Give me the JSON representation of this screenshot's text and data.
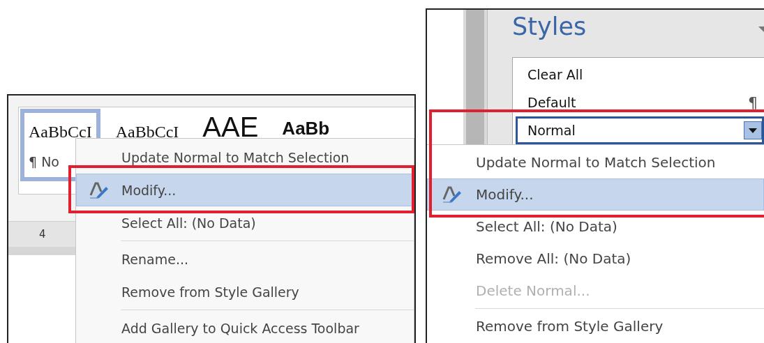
{
  "left_screenshot": {
    "style_gallery": [
      {
        "sample": "AaBbCcI",
        "name": "¶ No",
        "kind": "normal",
        "selected": true
      },
      {
        "sample": "AaBbCcI",
        "kind": "normal",
        "selected": false
      },
      {
        "sample": "AAE",
        "kind": "title",
        "selected": false
      },
      {
        "sample": "AaBb",
        "kind": "heading",
        "selected": false
      }
    ],
    "ruler": {
      "marker": "4"
    },
    "context_menu": [
      {
        "kind": "item",
        "label": "Update Normal to Match Selection",
        "selected": false
      },
      {
        "kind": "icon_item",
        "label": "Modify...",
        "selected": true
      },
      {
        "kind": "item",
        "label": "Select All: (No Data)",
        "selected": false
      },
      {
        "kind": "separator"
      },
      {
        "kind": "item",
        "label": "Rename...",
        "selected": false
      },
      {
        "kind": "item",
        "label": "Remove from Style Gallery",
        "selected": false
      },
      {
        "kind": "separator"
      },
      {
        "kind": "item",
        "label": "Add Gallery to Quick Access Toolbar",
        "selected": false
      }
    ]
  },
  "right_screenshot": {
    "pane_title": "Styles",
    "styles_list": [
      {
        "label": "Clear All",
        "selected": false
      },
      {
        "label": "Default",
        "mark": "¶",
        "selected": false
      },
      {
        "label": "Normal",
        "selected": true
      }
    ],
    "context_menu": [
      {
        "kind": "item",
        "label": "Update Normal to Match Selection",
        "selected": false,
        "disabled": false
      },
      {
        "kind": "icon_item",
        "label": "Modify...",
        "selected": true,
        "disabled": false
      },
      {
        "kind": "item",
        "label": "Select All: (No Data)",
        "selected": false,
        "disabled": false
      },
      {
        "kind": "item",
        "label": "Remove All: (No Data)",
        "selected": false,
        "disabled": false
      },
      {
        "kind": "item",
        "label": "Delete Normal...",
        "selected": false,
        "disabled": true
      },
      {
        "kind": "separator"
      },
      {
        "kind": "item",
        "label": "Remove from Style Gallery",
        "selected": false,
        "disabled": false
      }
    ]
  }
}
